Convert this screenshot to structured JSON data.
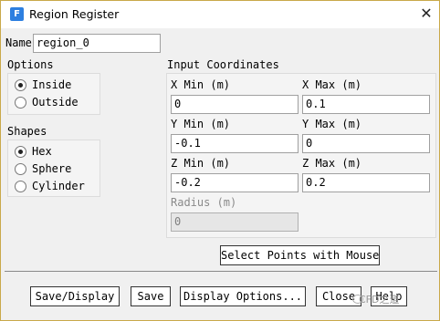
{
  "window": {
    "title": "Region Register",
    "app_icon": "F"
  },
  "name_field": {
    "label": "Name",
    "value": "region_0"
  },
  "options": {
    "label": "Options",
    "items": [
      {
        "label": "Inside",
        "selected": true
      },
      {
        "label": "Outside",
        "selected": false
      }
    ]
  },
  "shapes": {
    "label": "Shapes",
    "items": [
      {
        "label": "Hex",
        "selected": true
      },
      {
        "label": "Sphere",
        "selected": false
      },
      {
        "label": "Cylinder",
        "selected": false
      }
    ]
  },
  "coords": {
    "label": "Input Coordinates",
    "x_min": {
      "label": "X Min (m)",
      "value": "0"
    },
    "x_max": {
      "label": "X Max (m)",
      "value": "0.1"
    },
    "y_min": {
      "label": "Y Min (m)",
      "value": "-0.1"
    },
    "y_max": {
      "label": "Y Max (m)",
      "value": "0"
    },
    "z_min": {
      "label": "Z Min (m)",
      "value": "-0.2"
    },
    "z_max": {
      "label": "Z Max (m)",
      "value": "0.2"
    },
    "radius": {
      "label": "Radius (m)",
      "value": "0",
      "disabled": true
    }
  },
  "select_points_button": "Select Points with Mouse",
  "buttons": {
    "save_display": "Save/Display",
    "save": "Save",
    "display_options": "Display Options...",
    "close": "Close",
    "help": "Help"
  },
  "watermark": "CFD之道"
}
